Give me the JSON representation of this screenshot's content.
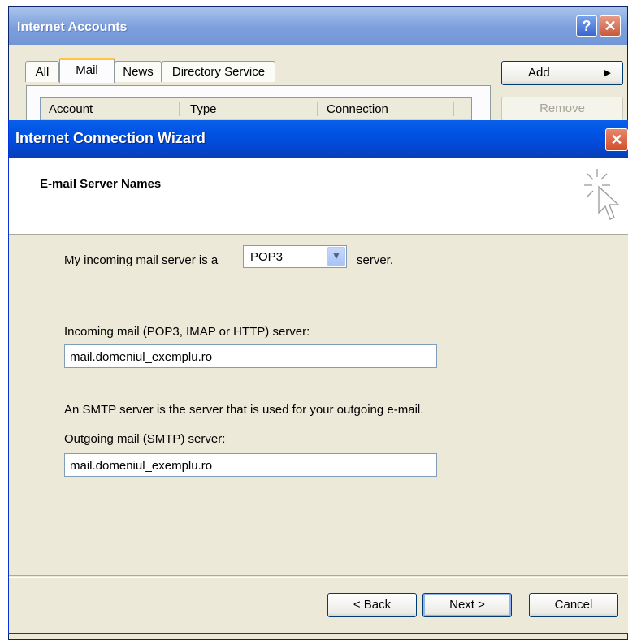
{
  "accounts_window": {
    "title": "Internet Accounts",
    "help_glyph": "?",
    "close_glyph": "✕",
    "tabs": [
      {
        "label": "All",
        "selected": false
      },
      {
        "label": "Mail",
        "selected": true
      },
      {
        "label": "News",
        "selected": false
      },
      {
        "label": "Directory Service",
        "selected": false
      }
    ],
    "columns": [
      "Account",
      "Type",
      "Connection"
    ],
    "add_button": "Add",
    "add_arrow": "▶",
    "remove_button": "Remove"
  },
  "wizard": {
    "title": "Internet Connection Wizard",
    "close_glyph": "✕",
    "heading": "E-mail Server Names",
    "incoming_prefix": "My incoming mail server is a",
    "server_type": {
      "selected": "POP3"
    },
    "incoming_suffix": "server.",
    "incoming_label": "Incoming mail (POP3, IMAP or HTTP) server:",
    "incoming_value": "mail.domeniul_exemplu.ro",
    "smtp_note": "An SMTP server is the server that is used for your outgoing e-mail.",
    "outgoing_label": "Outgoing mail (SMTP) server:",
    "outgoing_value": "mail.domeniul_exemplu.ro",
    "buttons": {
      "back": "< Back",
      "next": "Next >",
      "cancel": "Cancel"
    }
  },
  "colors": {
    "accent": "#0055e5",
    "tab_highlight": "#ffc83c",
    "close": "#d24f28"
  }
}
